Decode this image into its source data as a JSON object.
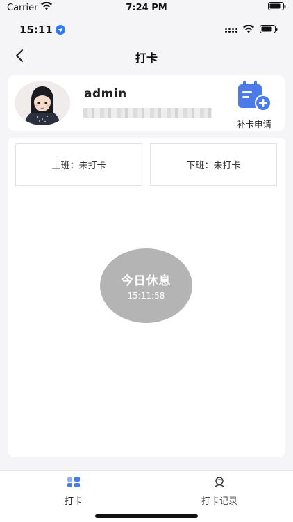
{
  "sim_status": {
    "carrier": "Carrier",
    "time": "7:24 PM"
  },
  "device_status": {
    "time": "15:11"
  },
  "nav": {
    "title": "打卡"
  },
  "profile": {
    "name": "admin",
    "makeup_label": "补卡申请"
  },
  "shifts": {
    "on_duty": "上班：未打卡",
    "off_duty": "下班：未打卡"
  },
  "rest": {
    "title": "今日休息",
    "time": "15:11:58"
  },
  "tabs": [
    {
      "label": "打卡",
      "icon": "punch-icon"
    },
    {
      "label": "打卡记录",
      "icon": "record-icon"
    }
  ],
  "colors": {
    "accent": "#4a7be8",
    "rest_circle": "#b4b4b4"
  }
}
